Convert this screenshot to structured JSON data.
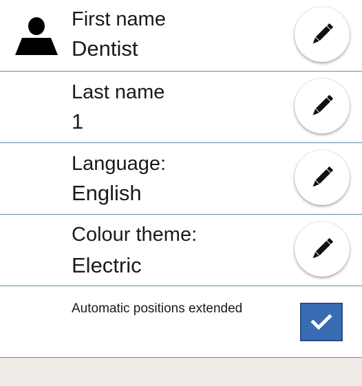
{
  "profile": {
    "first_name": {
      "label": "First name",
      "value": "Dentist",
      "icon": "pencil-icon"
    },
    "last_name": {
      "label": "Last name",
      "value": "1",
      "icon": "pencil-icon"
    },
    "language": {
      "label": "Language:",
      "value": "English",
      "icon": "pencil-icon"
    },
    "colour_theme": {
      "label": "Colour theme:",
      "value": "Electric",
      "icon": "pencil-icon"
    },
    "automatic_positions": {
      "label": "Automatic positions extended",
      "checked": true
    }
  },
  "icons": {
    "avatar": "person-icon"
  },
  "colors": {
    "divider": "#5b8fa8",
    "checkbox_fill": "#3a6cb3",
    "bottom_bar": "#efebe7",
    "text": "#1a1a1a"
  }
}
